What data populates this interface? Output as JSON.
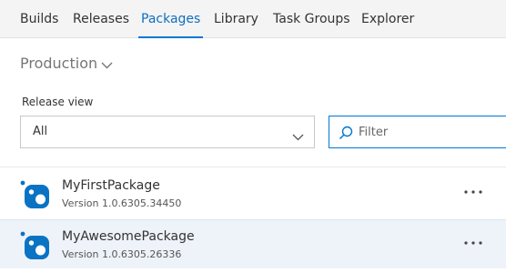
{
  "nav": {
    "tabs": [
      {
        "label": "Builds"
      },
      {
        "label": "Releases"
      },
      {
        "label": "Packages",
        "active": true
      },
      {
        "label": "Library"
      },
      {
        "label": "Task Groups"
      },
      {
        "label": "Explorer"
      }
    ]
  },
  "feed": {
    "name": "Production",
    "icon": "chevron-down-icon"
  },
  "release_view": {
    "label": "Release view",
    "selected": "All",
    "icon": "chevron-down-icon"
  },
  "filter": {
    "placeholder": "Filter",
    "value": "",
    "icon": "search-icon"
  },
  "packages": [
    {
      "name": "MyFirstPackage",
      "version": "Version 1.0.6305.34450",
      "icon": "nuget-package-icon",
      "more_icon": "ellipsis-icon"
    },
    {
      "name": "MyAwesomePackage",
      "version": "Version 1.0.6305.26336",
      "icon": "nuget-package-icon",
      "more_icon": "ellipsis-icon",
      "selected": true
    }
  ],
  "colors": {
    "accent": "#0078d7",
    "active_tab_text": "#106ebe",
    "nav_background": "#f4f4f4",
    "selected_row": "#eef3f9",
    "package_icon": "#0a73c4"
  }
}
